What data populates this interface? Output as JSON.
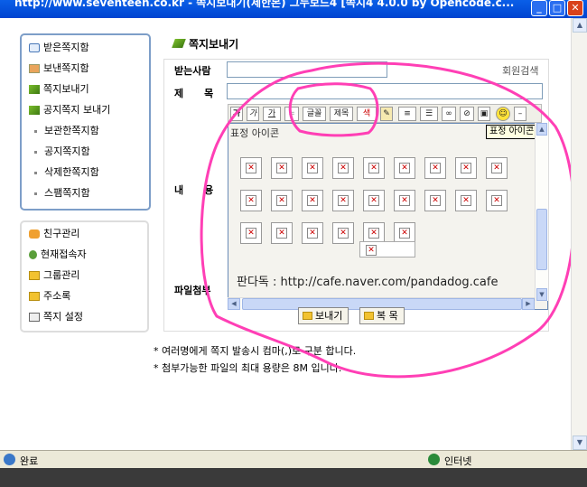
{
  "window": {
    "title": "http://www.seventeen.co.kr - 쪽지보내기(제한본) 그누보드4 [쪽지4 4.0.0 by Opencode.c..."
  },
  "sidebar": {
    "main_items": [
      {
        "label": "받은쪽지함",
        "icon": "envelope-open-icon"
      },
      {
        "label": "보낸쪽지함",
        "icon": "envelope-send-icon"
      },
      {
        "label": "쪽지보내기",
        "icon": "pen-icon"
      },
      {
        "label": "공지쪽지 보내기",
        "icon": "pen-icon"
      }
    ],
    "sub_items": [
      {
        "label": "보관한쪽지함"
      },
      {
        "label": "공지쪽지함"
      },
      {
        "label": "삭제한쪽지함"
      },
      {
        "label": "스팸쪽지함"
      }
    ],
    "tools": [
      {
        "label": "친구관리",
        "icon": "friends-icon"
      },
      {
        "label": "현재접속자",
        "icon": "user-online-icon"
      },
      {
        "label": "그룹관리",
        "icon": "folder-icon"
      },
      {
        "label": "주소록",
        "icon": "folder-icon"
      },
      {
        "label": "쪽지 설정",
        "icon": "settings-icon"
      }
    ]
  },
  "form": {
    "heading": "쪽지보내기",
    "recipient_label": "받는사람",
    "member_search": "회원검색",
    "subject_label": "제      목",
    "content_label": "내      용",
    "attach_label": "파일첨부",
    "toolbar": {
      "bold": "가",
      "italic": "가",
      "underline": "가",
      "font": "글꼴",
      "size": "제목",
      "color": "색",
      "emoticon_tooltip": "표정 아이콘"
    },
    "emoticon_panel_title": "표정 아이콘",
    "watermark": "판다독 : http://cafe.naver.com/pandadog.cafe",
    "send_button": "보내기",
    "back_button": "복 목"
  },
  "notes": [
    "* 여러명에게 쪽지 발송시 컴마(,)로 구분 합니다.",
    "* 첨부가능한 파일의 최대 용량은 8M 입니다."
  ],
  "statusbar": {
    "status": "완료",
    "zone": "인터넷"
  },
  "colors": {
    "title_bar": "#0a5fe8",
    "annotation": "#ff3fb5",
    "panel_border": "#6a8bb7"
  }
}
